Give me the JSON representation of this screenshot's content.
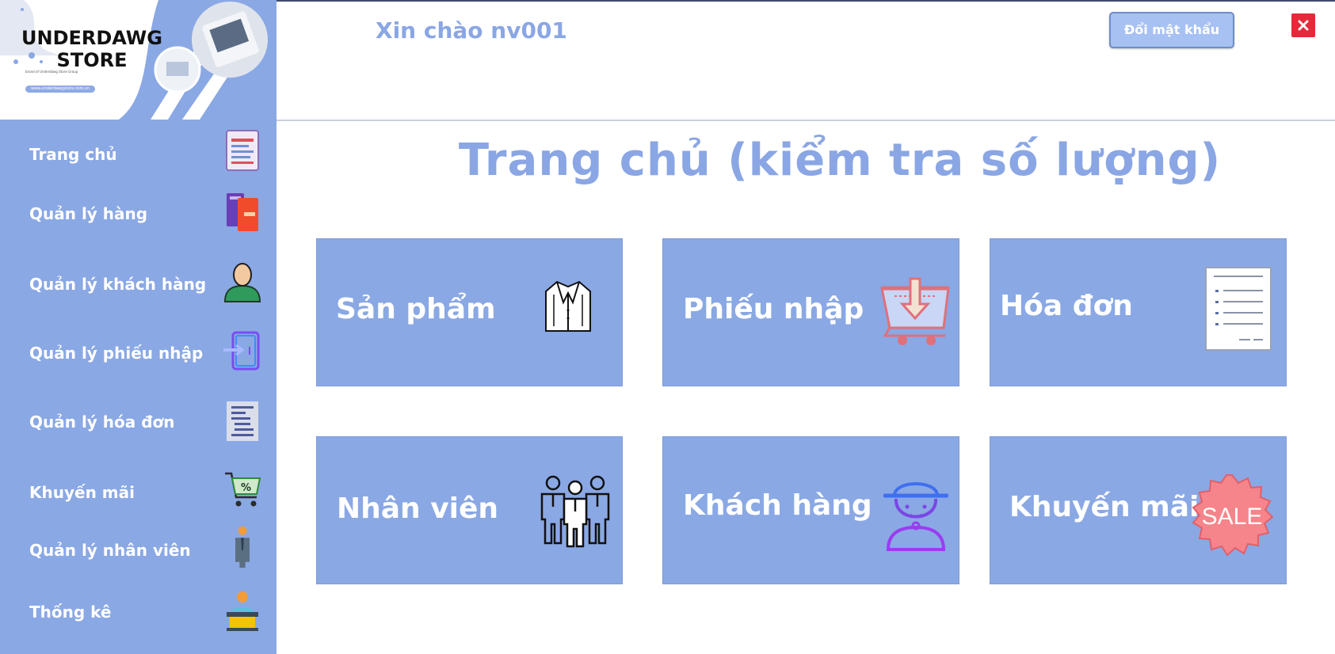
{
  "app": {
    "logo_text_line1": "UNDERDAWG",
    "logo_text_line2": "STORE",
    "logo_subtitle": "brand of Underdawg Store Group",
    "logo_url": "www.underdawgstore.com.vn"
  },
  "header": {
    "greeting": "Xin chào nv001",
    "change_password_label": "Đổi mật khẩu",
    "close_label": "×"
  },
  "sidebar": {
    "items": [
      {
        "label": "Trang chủ",
        "icon": "document-icon"
      },
      {
        "label": "Quản lý hàng",
        "icon": "books-icon"
      },
      {
        "label": "Quản lý khách hàng",
        "icon": "person-icon"
      },
      {
        "label": "Quản lý phiếu nhập",
        "icon": "door-enter-icon"
      },
      {
        "label": "Quản lý hóa đơn",
        "icon": "invoice-icon"
      },
      {
        "label": "Khuyến mãi",
        "icon": "cart-percent-icon"
      },
      {
        "label": "Quản lý nhân viên",
        "icon": "employee-icon"
      },
      {
        "label": "Thống kê",
        "icon": "statistics-person-icon"
      }
    ]
  },
  "main": {
    "title": "Trang chủ (kiểm tra số lượng)",
    "tiles": [
      {
        "label": "Sản phẩm",
        "icon": "jacket-icon"
      },
      {
        "label": "Phiếu nhập",
        "icon": "basket-import-icon"
      },
      {
        "label": "Hóa đơn",
        "icon": "receipt-icon"
      },
      {
        "label": "Nhân viên",
        "icon": "staff-group-icon"
      },
      {
        "label": "Khách hàng",
        "icon": "customer-hat-icon"
      },
      {
        "label": "Khuyến mãi",
        "icon": "sale-badge-icon"
      }
    ],
    "sale_badge_text": "SALE"
  },
  "colors": {
    "accent": "#8aa8e4",
    "title": "#8aa6e4",
    "close": "#e5293a",
    "button": "#a7c1f3"
  }
}
